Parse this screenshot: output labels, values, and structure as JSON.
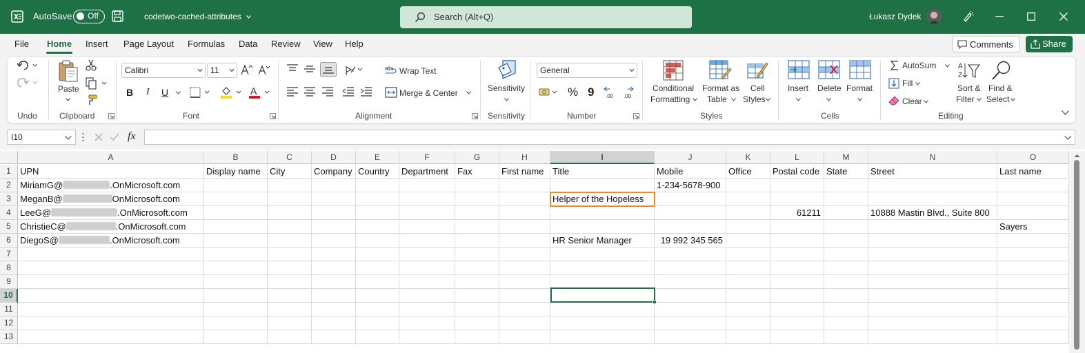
{
  "titlebar": {
    "autosave_label": "AutoSave",
    "autosave_state": "Off",
    "document_name": "codetwo-cached-attributes",
    "search_placeholder": "Search (Alt+Q)",
    "user_name": "Łukasz Dydek",
    "brand_color": "#1e7145"
  },
  "menu": {
    "items": [
      "File",
      "Home",
      "Insert",
      "Page Layout",
      "Formulas",
      "Data",
      "Review",
      "View",
      "Help"
    ],
    "active": "Home",
    "comments_label": "Comments",
    "share_label": "Share"
  },
  "ribbon": {
    "groups": {
      "undo": "Undo",
      "clipboard": "Clipboard",
      "font": "Font",
      "alignment": "Alignment",
      "sensitivity": "Sensitivity",
      "number": "Number",
      "styles": "Styles",
      "cells": "Cells",
      "editing": "Editing"
    },
    "paste_label": "Paste",
    "font_name": "Calibri",
    "font_size": "11",
    "wrap_text": "Wrap Text",
    "merge_center": "Merge & Center",
    "sensitivity_label": "Sensitivity",
    "number_format": "General",
    "conditional_formatting": [
      "Conditional",
      "Formatting"
    ],
    "format_as_table": [
      "Format as",
      "Table"
    ],
    "cell_styles": [
      "Cell",
      "Styles"
    ],
    "insert_label": "Insert",
    "delete_label": "Delete",
    "format_label": "Format",
    "autosum_label": "AutoSum",
    "fill_label": "Fill",
    "clear_label": "Clear",
    "sort_filter": [
      "Sort &",
      "Filter"
    ],
    "find_select": [
      "Find &",
      "Select"
    ],
    "bold": "B",
    "italic": "I",
    "underline": "U",
    "font_color_letter": "A",
    "percent": "%",
    "comma": "9"
  },
  "formula_bar": {
    "name_box": "I10",
    "fx_label": "fx",
    "formula": ""
  },
  "sheet": {
    "columns": [
      "A",
      "B",
      "C",
      "D",
      "E",
      "F",
      "G",
      "H",
      "I",
      "J",
      "K",
      "L",
      "M",
      "N",
      "O"
    ],
    "selected_column": "I",
    "selected_row": "10",
    "row_numbers": [
      "1",
      "2",
      "3",
      "4",
      "5",
      "6",
      "7",
      "8",
      "9",
      "10",
      "11",
      "12",
      "13"
    ],
    "headers": [
      "UPN",
      "Display name",
      "City",
      "Company",
      "Country",
      "Department",
      "Fax",
      "First name",
      "Title",
      "Mobile",
      "Office",
      "Postal code",
      "State",
      "Street",
      "Last name"
    ],
    "upn_rows": [
      {
        "prefix": "MiriamG@",
        "suffix": ".OnMicrosoft.com"
      },
      {
        "prefix": "MeganB@",
        "suffix": "OnMicrosoft.com"
      },
      {
        "prefix": "LeeG@",
        "suffix": ".OnMicrosoft.com"
      },
      {
        "prefix": "ChristieC@",
        "suffix": ".OnMicrosoft.com"
      },
      {
        "prefix": "DiegoS@",
        "suffix": ".OnMicrosoft.com"
      }
    ],
    "values": {
      "J2": "1-234-5678-900",
      "I3": "Helper of the Hopeless",
      "L4": "61211",
      "N4": "10888 Mastin Blvd., Suite 800",
      "O5": "Sayers",
      "I6": "HR Senior Manager",
      "J6": "19 992 345 565"
    },
    "highlight_color": "#f08a24"
  }
}
